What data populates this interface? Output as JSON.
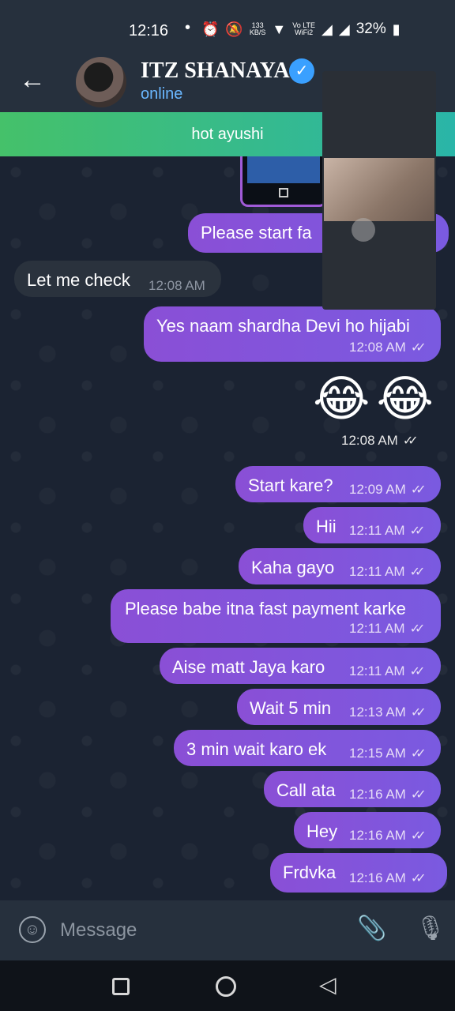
{
  "status_bar": {
    "time": "12:16",
    "dot": "•",
    "net_speed_top": "133",
    "net_speed_unit": "KB/S",
    "volte_label": "Vo LTE",
    "wifi_label": "WiFi2",
    "battery": "32%"
  },
  "header": {
    "back_icon": "←",
    "contact_name": "ITZ SHANAYA",
    "verified_icon": "✓",
    "status": "online"
  },
  "pinned": {
    "text": "hot ayushi"
  },
  "messages": [
    {
      "text": "Please start fa",
      "time": "",
      "dir": "out"
    },
    {
      "text": "Let me check",
      "time": "12:08 AM",
      "dir": "in"
    },
    {
      "text": "Yes naam shardha Devi ho hijabi",
      "time": "12:08 AM",
      "dir": "out"
    },
    {
      "text": "Start kare?",
      "time": "12:09 AM",
      "dir": "out"
    },
    {
      "text": "Hii",
      "time": "12:11 AM",
      "dir": "out"
    },
    {
      "text": "Kaha gayo",
      "time": "12:11 AM",
      "dir": "out"
    },
    {
      "text": "Please babe itna fast payment karke",
      "time": "12:11 AM",
      "dir": "out"
    },
    {
      "text": "Aise matt Jaya karo",
      "time": "12:11 AM",
      "dir": "out"
    },
    {
      "text": "Wait 5 min",
      "time": "12:13 AM",
      "dir": "out"
    },
    {
      "text": "3 min wait karo ek",
      "time": "12:15 AM",
      "dir": "out"
    },
    {
      "text": "Call ata",
      "time": "12:16 AM",
      "dir": "out"
    },
    {
      "text": "Hey",
      "time": "12:16 AM",
      "dir": "out"
    },
    {
      "text": "Frdvka",
      "time": "12:16 AM",
      "dir": "out"
    }
  ],
  "emoji_message": {
    "emojis": "😂😂",
    "time": "12:08 AM"
  },
  "ticks": "✓✓",
  "input": {
    "placeholder": "Message",
    "emoji_icon": "☺",
    "attach_icon": "📎",
    "mic_icon": "🎙"
  },
  "nav": {
    "back_icon": "◁"
  },
  "colors": {
    "outgoing_bubble": "#8a4fd6",
    "incoming_bubble": "#2a323d",
    "pinned_banner": "#45c16a",
    "online_status": "#6ab7ff",
    "verified_badge": "#3aa0ff"
  }
}
